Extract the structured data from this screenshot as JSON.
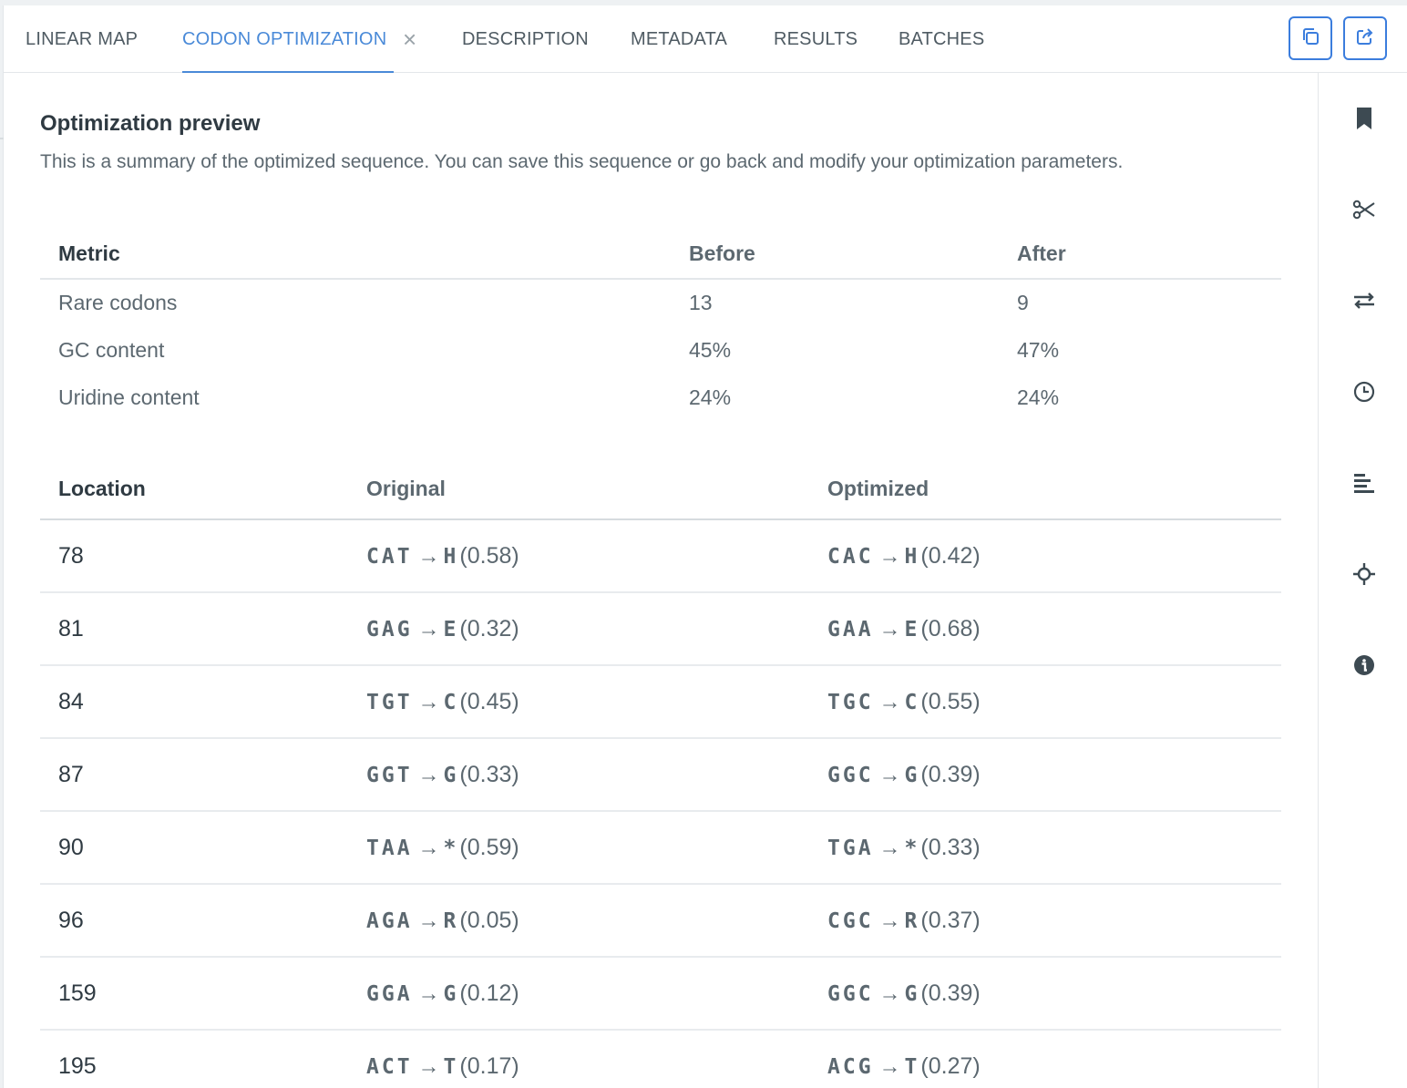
{
  "tabs": [
    {
      "label": "LINEAR MAP"
    },
    {
      "label": "CODON OPTIMIZATION",
      "active": true
    },
    {
      "label": "DESCRIPTION"
    },
    {
      "label": "METADATA"
    },
    {
      "label": "RESULTS"
    },
    {
      "label": "BATCHES"
    }
  ],
  "tab_close_glyph": "×",
  "header_buttons": [
    {
      "icon": "duplicate-icon"
    },
    {
      "icon": "share-icon"
    }
  ],
  "preview": {
    "title": "Optimization preview",
    "subtitle": "This is a summary of the optimized sequence. You can save this sequence or go back and modify your optimization parameters."
  },
  "metrics_table": {
    "headers": [
      "Metric",
      "Before",
      "After"
    ],
    "rows": [
      [
        "Rare codons",
        "13",
        "9"
      ],
      [
        "GC content",
        "45%",
        "47%"
      ],
      [
        "Uridine content",
        "24%",
        "24%"
      ]
    ]
  },
  "changes_table": {
    "headers": [
      "Location",
      "Original",
      "Optimized"
    ],
    "arrow": "→",
    "rows": [
      {
        "location": "78",
        "original": {
          "codon": "CAT",
          "aa": "H",
          "score": "(0.58)"
        },
        "optimized": {
          "codon": "CAC",
          "aa": "H",
          "score": "(0.42)"
        }
      },
      {
        "location": "81",
        "original": {
          "codon": "GAG",
          "aa": "E",
          "score": "(0.32)"
        },
        "optimized": {
          "codon": "GAA",
          "aa": "E",
          "score": "(0.68)"
        }
      },
      {
        "location": "84",
        "original": {
          "codon": "TGT",
          "aa": "C",
          "score": "(0.45)"
        },
        "optimized": {
          "codon": "TGC",
          "aa": "C",
          "score": "(0.55)"
        }
      },
      {
        "location": "87",
        "original": {
          "codon": "GGT",
          "aa": "G",
          "score": "(0.33)"
        },
        "optimized": {
          "codon": "GGC",
          "aa": "G",
          "score": "(0.39)"
        }
      },
      {
        "location": "90",
        "original": {
          "codon": "TAA",
          "aa": "*",
          "score": "(0.59)"
        },
        "optimized": {
          "codon": "TGA",
          "aa": "*",
          "score": "(0.33)"
        }
      },
      {
        "location": "96",
        "original": {
          "codon": "AGA",
          "aa": "R",
          "score": "(0.05)"
        },
        "optimized": {
          "codon": "CGC",
          "aa": "R",
          "score": "(0.37)"
        }
      },
      {
        "location": "159",
        "original": {
          "codon": "GGA",
          "aa": "G",
          "score": "(0.12)"
        },
        "optimized": {
          "codon": "GGC",
          "aa": "G",
          "score": "(0.39)"
        }
      },
      {
        "location": "195",
        "original": {
          "codon": "ACT",
          "aa": "T",
          "score": "(0.17)"
        },
        "optimized": {
          "codon": "ACG",
          "aa": "T",
          "score": "(0.27)"
        }
      }
    ]
  },
  "sidebar_icons": [
    "bookmark-icon",
    "scissors-icon",
    "swap-icon",
    "history-icon",
    "alignment-icon",
    "target-icon",
    "info-icon"
  ],
  "colors": {
    "accent": "#4a8ad8",
    "button_border": "#3b7ddd",
    "icon": "#3d4a52",
    "text": "#5c6870",
    "heading": "#2f3a42"
  }
}
